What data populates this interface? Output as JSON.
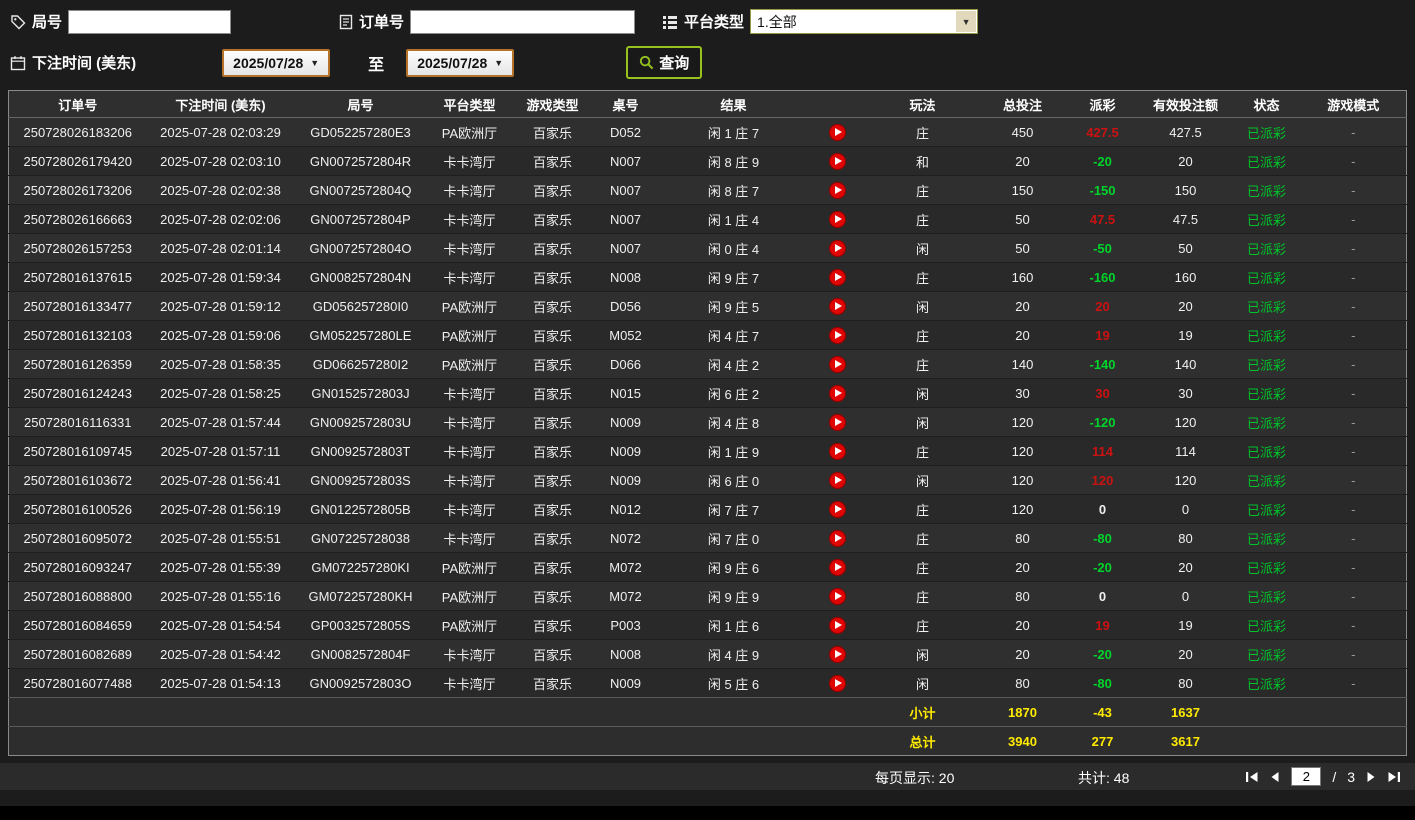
{
  "filters": {
    "round_label": "局号",
    "order_label": "订单号",
    "platform_label": "平台类型",
    "platform_value": "1.全部",
    "time_label": "下注时间 (美东)",
    "date_from": "2025/07/28",
    "date_to": "2025/07/28",
    "to_label": "至",
    "search_label": "查询"
  },
  "icons": {
    "round": "tag-icon",
    "order": "document-icon",
    "platform": "list-icon",
    "time": "calendar-icon",
    "search": "magnifier-icon",
    "result_replay": "play-circle-icon",
    "pager": [
      "first",
      "prev",
      "next",
      "last"
    ]
  },
  "colors": {
    "background": "#1c1c1c",
    "table_row": "#2d2d2d",
    "payout_positive_red": "#cc1111",
    "payout_negative_green": "#00d42a",
    "status_green": "#00c32a",
    "summary_yellow": "#ffeb00",
    "play_icon_red": "#e00505",
    "query_border_green": "#96c11f",
    "date_border_orange": "#b5722a"
  },
  "table": {
    "headers": [
      "订单号",
      "下注时间 (美东)",
      "局号",
      "平台类型",
      "游戏类型",
      "桌号",
      "结果",
      "",
      "玩法",
      "总投注",
      "派彩",
      "有效投注额",
      "状态",
      "游戏模式"
    ],
    "rows": [
      {
        "order_id": "250728026183206",
        "bet_time": "2025-07-28 02:03:29",
        "round_id": "GD052257280E3",
        "platform": "PA欧洲厅",
        "game_type": "百家乐",
        "table_no": "D052",
        "result": "闲 1 庄 7",
        "play": "庄",
        "total_bet": "450",
        "payout": "427.5",
        "valid_bet": "427.5",
        "status": "已派彩",
        "game_mode": "-"
      },
      {
        "order_id": "250728026179420",
        "bet_time": "2025-07-28 02:03:10",
        "round_id": "GN0072572804R",
        "platform": "卡卡湾厅",
        "game_type": "百家乐",
        "table_no": "N007",
        "result": "闲 8 庄 9",
        "play": "和",
        "total_bet": "20",
        "payout": "-20",
        "valid_bet": "20",
        "status": "已派彩",
        "game_mode": "-"
      },
      {
        "order_id": "250728026173206",
        "bet_time": "2025-07-28 02:02:38",
        "round_id": "GN0072572804Q",
        "platform": "卡卡湾厅",
        "game_type": "百家乐",
        "table_no": "N007",
        "result": "闲 8 庄 7",
        "play": "庄",
        "total_bet": "150",
        "payout": "-150",
        "valid_bet": "150",
        "status": "已派彩",
        "game_mode": "-"
      },
      {
        "order_id": "250728026166663",
        "bet_time": "2025-07-28 02:02:06",
        "round_id": "GN0072572804P",
        "platform": "卡卡湾厅",
        "game_type": "百家乐",
        "table_no": "N007",
        "result": "闲 1 庄 4",
        "play": "庄",
        "total_bet": "50",
        "payout": "47.5",
        "valid_bet": "47.5",
        "status": "已派彩",
        "game_mode": "-"
      },
      {
        "order_id": "250728026157253",
        "bet_time": "2025-07-28 02:01:14",
        "round_id": "GN0072572804O",
        "platform": "卡卡湾厅",
        "game_type": "百家乐",
        "table_no": "N007",
        "result": "闲 0 庄 4",
        "play": "闲",
        "total_bet": "50",
        "payout": "-50",
        "valid_bet": "50",
        "status": "已派彩",
        "game_mode": "-"
      },
      {
        "order_id": "250728016137615",
        "bet_time": "2025-07-28 01:59:34",
        "round_id": "GN0082572804N",
        "platform": "卡卡湾厅",
        "game_type": "百家乐",
        "table_no": "N008",
        "result": "闲 9 庄 7",
        "play": "庄",
        "total_bet": "160",
        "payout": "-160",
        "valid_bet": "160",
        "status": "已派彩",
        "game_mode": "-"
      },
      {
        "order_id": "250728016133477",
        "bet_time": "2025-07-28 01:59:12",
        "round_id": "GD056257280I0",
        "platform": "PA欧洲厅",
        "game_type": "百家乐",
        "table_no": "D056",
        "result": "闲 9 庄 5",
        "play": "闲",
        "total_bet": "20",
        "payout": "20",
        "valid_bet": "20",
        "status": "已派彩",
        "game_mode": "-"
      },
      {
        "order_id": "250728016132103",
        "bet_time": "2025-07-28 01:59:06",
        "round_id": "GM052257280LE",
        "platform": "PA欧洲厅",
        "game_type": "百家乐",
        "table_no": "M052",
        "result": "闲 4 庄 7",
        "play": "庄",
        "total_bet": "20",
        "payout": "19",
        "valid_bet": "19",
        "status": "已派彩",
        "game_mode": "-"
      },
      {
        "order_id": "250728016126359",
        "bet_time": "2025-07-28 01:58:35",
        "round_id": "GD066257280I2",
        "platform": "PA欧洲厅",
        "game_type": "百家乐",
        "table_no": "D066",
        "result": "闲 4 庄 2",
        "play": "庄",
        "total_bet": "140",
        "payout": "-140",
        "valid_bet": "140",
        "status": "已派彩",
        "game_mode": "-"
      },
      {
        "order_id": "250728016124243",
        "bet_time": "2025-07-28 01:58:25",
        "round_id": "GN0152572803J",
        "platform": "卡卡湾厅",
        "game_type": "百家乐",
        "table_no": "N015",
        "result": "闲 6 庄 2",
        "play": "闲",
        "total_bet": "30",
        "payout": "30",
        "valid_bet": "30",
        "status": "已派彩",
        "game_mode": "-"
      },
      {
        "order_id": "250728016116331",
        "bet_time": "2025-07-28 01:57:44",
        "round_id": "GN0092572803U",
        "platform": "卡卡湾厅",
        "game_type": "百家乐",
        "table_no": "N009",
        "result": "闲 4 庄 8",
        "play": "闲",
        "total_bet": "120",
        "payout": "-120",
        "valid_bet": "120",
        "status": "已派彩",
        "game_mode": "-"
      },
      {
        "order_id": "250728016109745",
        "bet_time": "2025-07-28 01:57:11",
        "round_id": "GN0092572803T",
        "platform": "卡卡湾厅",
        "game_type": "百家乐",
        "table_no": "N009",
        "result": "闲 1 庄 9",
        "play": "庄",
        "total_bet": "120",
        "payout": "114",
        "valid_bet": "114",
        "status": "已派彩",
        "game_mode": "-"
      },
      {
        "order_id": "250728016103672",
        "bet_time": "2025-07-28 01:56:41",
        "round_id": "GN0092572803S",
        "platform": "卡卡湾厅",
        "game_type": "百家乐",
        "table_no": "N009",
        "result": "闲 6 庄 0",
        "play": "闲",
        "total_bet": "120",
        "payout": "120",
        "valid_bet": "120",
        "status": "已派彩",
        "game_mode": "-"
      },
      {
        "order_id": "250728016100526",
        "bet_time": "2025-07-28 01:56:19",
        "round_id": "GN0122572805B",
        "platform": "卡卡湾厅",
        "game_type": "百家乐",
        "table_no": "N012",
        "result": "闲 7 庄 7",
        "play": "庄",
        "total_bet": "120",
        "payout": "0",
        "valid_bet": "0",
        "status": "已派彩",
        "game_mode": "-"
      },
      {
        "order_id": "250728016095072",
        "bet_time": "2025-07-28 01:55:51",
        "round_id": "GN07225728038",
        "platform": "卡卡湾厅",
        "game_type": "百家乐",
        "table_no": "N072",
        "result": "闲 7 庄 0",
        "play": "庄",
        "total_bet": "80",
        "payout": "-80",
        "valid_bet": "80",
        "status": "已派彩",
        "game_mode": "-"
      },
      {
        "order_id": "250728016093247",
        "bet_time": "2025-07-28 01:55:39",
        "round_id": "GM072257280KI",
        "platform": "PA欧洲厅",
        "game_type": "百家乐",
        "table_no": "M072",
        "result": "闲 9 庄 6",
        "play": "庄",
        "total_bet": "20",
        "payout": "-20",
        "valid_bet": "20",
        "status": "已派彩",
        "game_mode": "-"
      },
      {
        "order_id": "250728016088800",
        "bet_time": "2025-07-28 01:55:16",
        "round_id": "GM072257280KH",
        "platform": "PA欧洲厅",
        "game_type": "百家乐",
        "table_no": "M072",
        "result": "闲 9 庄 9",
        "play": "庄",
        "total_bet": "80",
        "payout": "0",
        "valid_bet": "0",
        "status": "已派彩",
        "game_mode": "-"
      },
      {
        "order_id": "250728016084659",
        "bet_time": "2025-07-28 01:54:54",
        "round_id": "GP0032572805S",
        "platform": "PA欧洲厅",
        "game_type": "百家乐",
        "table_no": "P003",
        "result": "闲 1 庄 6",
        "play": "庄",
        "total_bet": "20",
        "payout": "19",
        "valid_bet": "19",
        "status": "已派彩",
        "game_mode": "-"
      },
      {
        "order_id": "250728016082689",
        "bet_time": "2025-07-28 01:54:42",
        "round_id": "GN0082572804F",
        "platform": "卡卡湾厅",
        "game_type": "百家乐",
        "table_no": "N008",
        "result": "闲 4 庄 9",
        "play": "闲",
        "total_bet": "20",
        "payout": "-20",
        "valid_bet": "20",
        "status": "已派彩",
        "game_mode": "-"
      },
      {
        "order_id": "250728016077488",
        "bet_time": "2025-07-28 01:54:13",
        "round_id": "GN0092572803O",
        "platform": "卡卡湾厅",
        "game_type": "百家乐",
        "table_no": "N009",
        "result": "闲 5 庄 6",
        "play": "闲",
        "total_bet": "80",
        "payout": "-80",
        "valid_bet": "80",
        "status": "已派彩",
        "game_mode": "-"
      }
    ],
    "subtotal": {
      "label": "小计",
      "total_bet": "1870",
      "payout": "-43",
      "valid_bet": "1637"
    },
    "total": {
      "label": "总计",
      "total_bet": "3940",
      "payout": "277",
      "valid_bet": "3617"
    }
  },
  "footer": {
    "per_page": "每页显示: 20",
    "total_count": "共计: 48",
    "current_page": "2",
    "page_sep": "/",
    "total_pages": "3"
  }
}
